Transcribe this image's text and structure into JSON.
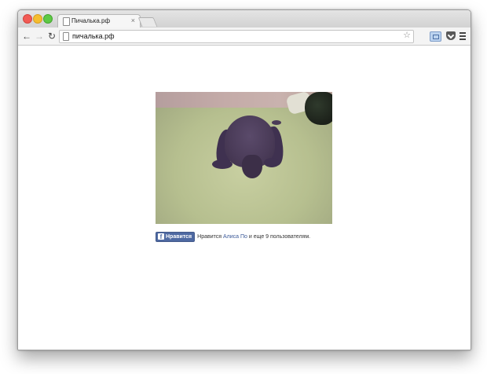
{
  "browser": {
    "tab": {
      "title": "Пичалька.рф",
      "close_symbol": "×"
    },
    "address_bar": {
      "url": "пичалька.рф"
    },
    "toolbar": {
      "back_symbol": "←",
      "forward_symbol": "→",
      "reload_symbol": "↻",
      "bookmark_symbol": "☆"
    },
    "icons": [
      "page-icon",
      "back-arrow-icon",
      "forward-arrow-icon",
      "reload-icon",
      "star-icon",
      "extension-icon",
      "pocket-icon",
      "menu-icon"
    ]
  },
  "page": {
    "photo": {
      "subject": "dog-photo"
    },
    "facebook_like": {
      "fb_symbol": "f",
      "button_label": "Нравится",
      "text_prefix": "Нравится",
      "friend_name": "Алиса По",
      "text_suffix": "и еще 9 пользователям."
    }
  },
  "colors": {
    "facebook_blue": "#4e69a2",
    "link_blue": "#3b5998"
  }
}
